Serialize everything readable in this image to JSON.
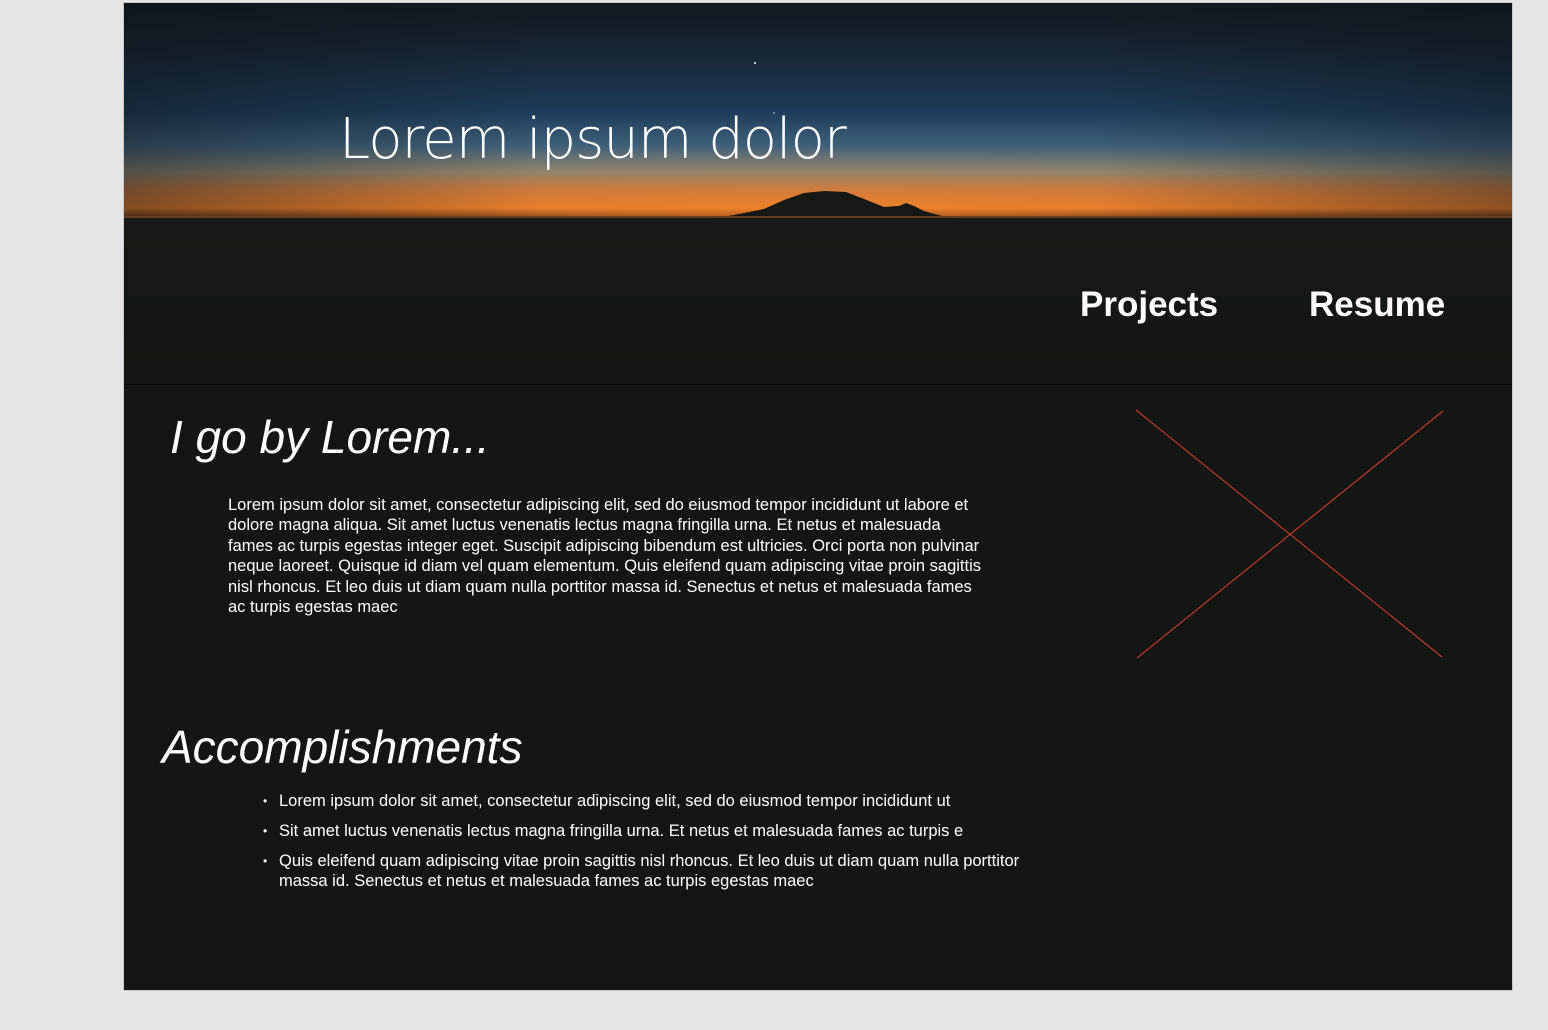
{
  "hero": {
    "title": "Lorem ipsum dolor",
    "background_image": "night-sky-mountain-sunset",
    "colors": {
      "sky_top": "#141b24",
      "sky_mid": "#1c3d5c",
      "horizon": "#e0782c",
      "ground": "#131612"
    }
  },
  "nav": {
    "projects_label": "Projects",
    "resume_label": "Resume"
  },
  "about": {
    "heading": "I go by Lorem...",
    "body": "Lorem ipsum dolor sit amet, consectetur adipiscing elit, sed do eiusmod tempor incididunt ut labore et dolore magna aliqua. Sit amet luctus venenatis lectus magna fringilla urna. Et netus et malesuada fames ac turpis egestas integer eget. Suscipit adipiscing bibendum est ultricies. Orci porta non pulvinar neque laoreet. Quisque id diam vel quam elementum. Quis eleifend quam adipiscing vitae proin sagittis nisl rhoncus. Et leo duis ut diam quam nulla porttitor massa id. Senectus et netus et malesuada fames ac turpis egestas maec"
  },
  "image_placeholder": {
    "icon": "image-placeholder-x-icon",
    "line_color": "#c0392b"
  },
  "accomplishments": {
    "heading": "Accomplishments",
    "items": [
      "Lorem ipsum dolor sit amet, consectetur adipiscing elit, sed do eiusmod tempor incididunt ut",
      "Sit amet luctus venenatis lectus magna fringilla urna. Et netus et malesuada fames ac turpis e",
      "Quis eleifend quam adipiscing vitae proin sagittis nisl rhoncus. Et leo duis ut diam quam nulla porttitor massa id. Senectus et netus et malesuada fames ac turpis egestas maec"
    ]
  },
  "theme": {
    "page_background": "#131612",
    "text_color": "#ffffff",
    "outer_background": "#e5e5e5"
  }
}
